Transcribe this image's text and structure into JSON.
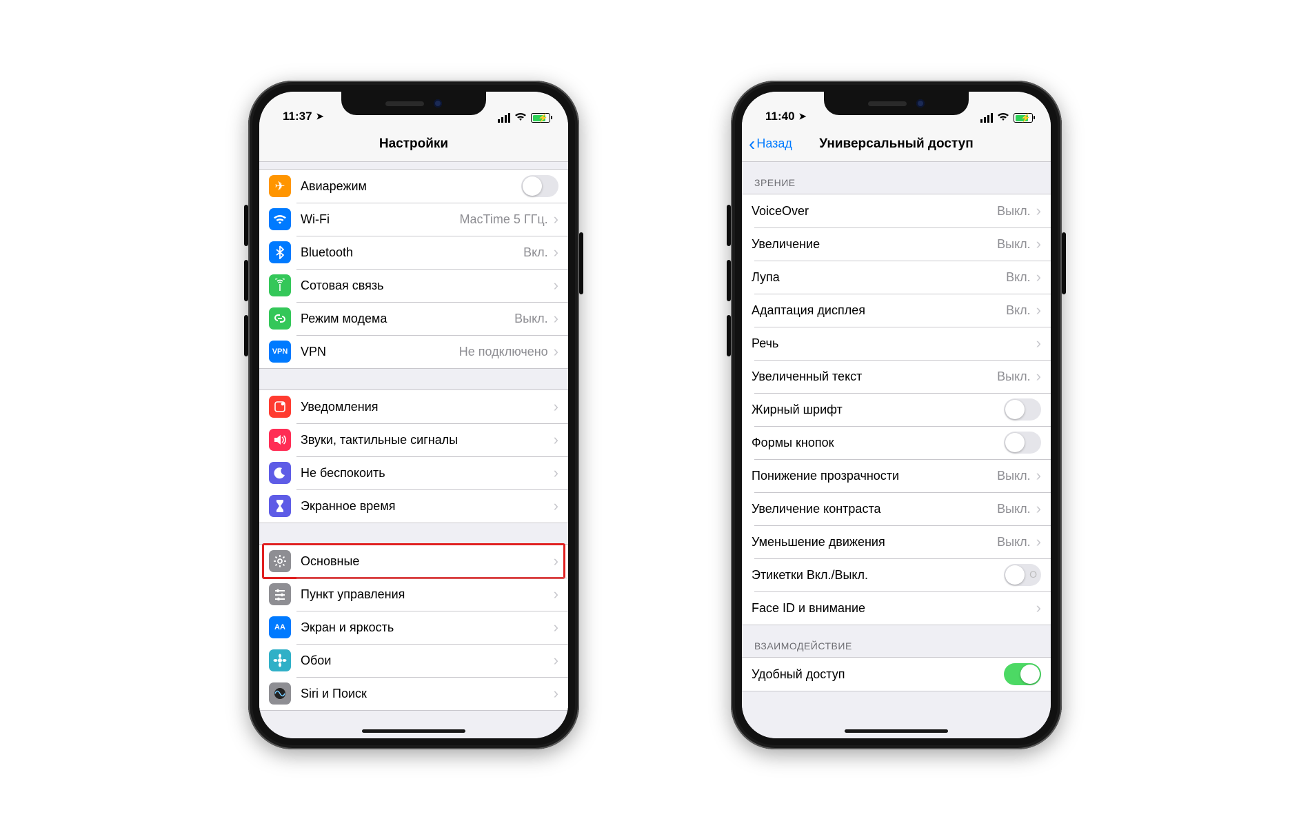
{
  "phone1": {
    "status_time": "11:37",
    "nav_title": "Настройки",
    "groups": [
      {
        "cells": [
          {
            "id": "airplane",
            "label": "Авиарежим",
            "type": "toggle",
            "on": false,
            "icon": "✈",
            "iconClass": "bg-orange"
          },
          {
            "id": "wifi",
            "label": "Wi-Fi",
            "detail": "MacTime 5 ГГц.",
            "type": "disclosure",
            "icon": "wifi",
            "iconClass": "bg-blue"
          },
          {
            "id": "bluetooth",
            "label": "Bluetooth",
            "detail": "Вкл.",
            "type": "disclosure",
            "icon": "bt",
            "iconClass": "bg-blue"
          },
          {
            "id": "cellular",
            "label": "Сотовая связь",
            "detail": "",
            "type": "disclosure",
            "icon": "ant",
            "iconClass": "bg-green"
          },
          {
            "id": "hotspot",
            "label": "Режим модема",
            "detail": "Выкл.",
            "type": "disclosure",
            "icon": "link",
            "iconClass": "bg-green"
          },
          {
            "id": "vpn",
            "label": "VPN",
            "detail": "Не подключено",
            "type": "disclosure",
            "icon": "VPN",
            "iconClass": "bg-blue",
            "iconText": true
          }
        ]
      },
      {
        "cells": [
          {
            "id": "notifications",
            "label": "Уведомления",
            "type": "disclosure",
            "icon": "bell",
            "iconClass": "bg-red"
          },
          {
            "id": "sounds",
            "label": "Звуки, тактильные сигналы",
            "type": "disclosure",
            "icon": "snd",
            "iconClass": "bg-pink"
          },
          {
            "id": "dnd",
            "label": "Не беспокоить",
            "type": "disclosure",
            "icon": "moon",
            "iconClass": "bg-indigo"
          },
          {
            "id": "screentime",
            "label": "Экранное время",
            "type": "disclosure",
            "icon": "hour",
            "iconClass": "bg-indigo"
          }
        ]
      },
      {
        "cells": [
          {
            "id": "general",
            "label": "Основные",
            "type": "disclosure",
            "icon": "gear",
            "iconClass": "bg-gray",
            "highlight": true
          },
          {
            "id": "control",
            "label": "Пункт управления",
            "type": "disclosure",
            "icon": "ctl",
            "iconClass": "bg-gray"
          },
          {
            "id": "display",
            "label": "Экран и яркость",
            "type": "disclosure",
            "icon": "AA",
            "iconClass": "bg-blue",
            "iconText": true
          },
          {
            "id": "wallpaper",
            "label": "Обои",
            "type": "disclosure",
            "icon": "flower",
            "iconClass": "bg-teal"
          },
          {
            "id": "siri",
            "label": "Siri и Поиск",
            "type": "disclosure",
            "icon": "siri",
            "iconClass": "bg-gray"
          }
        ]
      }
    ]
  },
  "phone2": {
    "status_time": "11:40",
    "back_label": "Назад",
    "nav_title": "Универсальный доступ",
    "sections": [
      {
        "header": "ЗРЕНИЕ",
        "cells": [
          {
            "id": "voiceover",
            "label": "VoiceOver",
            "detail": "Выкл.",
            "type": "disclosure"
          },
          {
            "id": "zoom",
            "label": "Увеличение",
            "detail": "Выкл.",
            "type": "disclosure"
          },
          {
            "id": "magnifier",
            "label": "Лупа",
            "detail": "Вкл.",
            "type": "disclosure"
          },
          {
            "id": "display-adapt",
            "label": "Адаптация дисплея",
            "detail": "Вкл.",
            "type": "disclosure"
          },
          {
            "id": "speech",
            "label": "Речь",
            "detail": "",
            "type": "disclosure"
          },
          {
            "id": "large-text",
            "label": "Увеличенный текст",
            "detail": "Выкл.",
            "type": "disclosure"
          },
          {
            "id": "bold",
            "label": "Жирный шрифт",
            "type": "toggle",
            "on": false
          },
          {
            "id": "button-shapes",
            "label": "Формы кнопок",
            "type": "toggle",
            "on": false
          },
          {
            "id": "transparency",
            "label": "Понижение прозрачности",
            "detail": "Выкл.",
            "type": "disclosure"
          },
          {
            "id": "contrast",
            "label": "Увеличение контраста",
            "detail": "Выкл.",
            "type": "disclosure"
          },
          {
            "id": "motion",
            "label": "Уменьшение движения",
            "detail": "Выкл.",
            "type": "disclosure"
          },
          {
            "id": "labels",
            "label": "Этикетки Вкл./Выкл.",
            "type": "toggle",
            "on": false,
            "io": true
          },
          {
            "id": "faceid",
            "label": "Face ID и внимание",
            "detail": "",
            "type": "disclosure"
          }
        ]
      },
      {
        "header": "ВЗАИМОДЕЙСТВИЕ",
        "cells": [
          {
            "id": "reachability",
            "label": "Удобный доступ",
            "type": "toggle",
            "on": true
          }
        ]
      }
    ]
  }
}
